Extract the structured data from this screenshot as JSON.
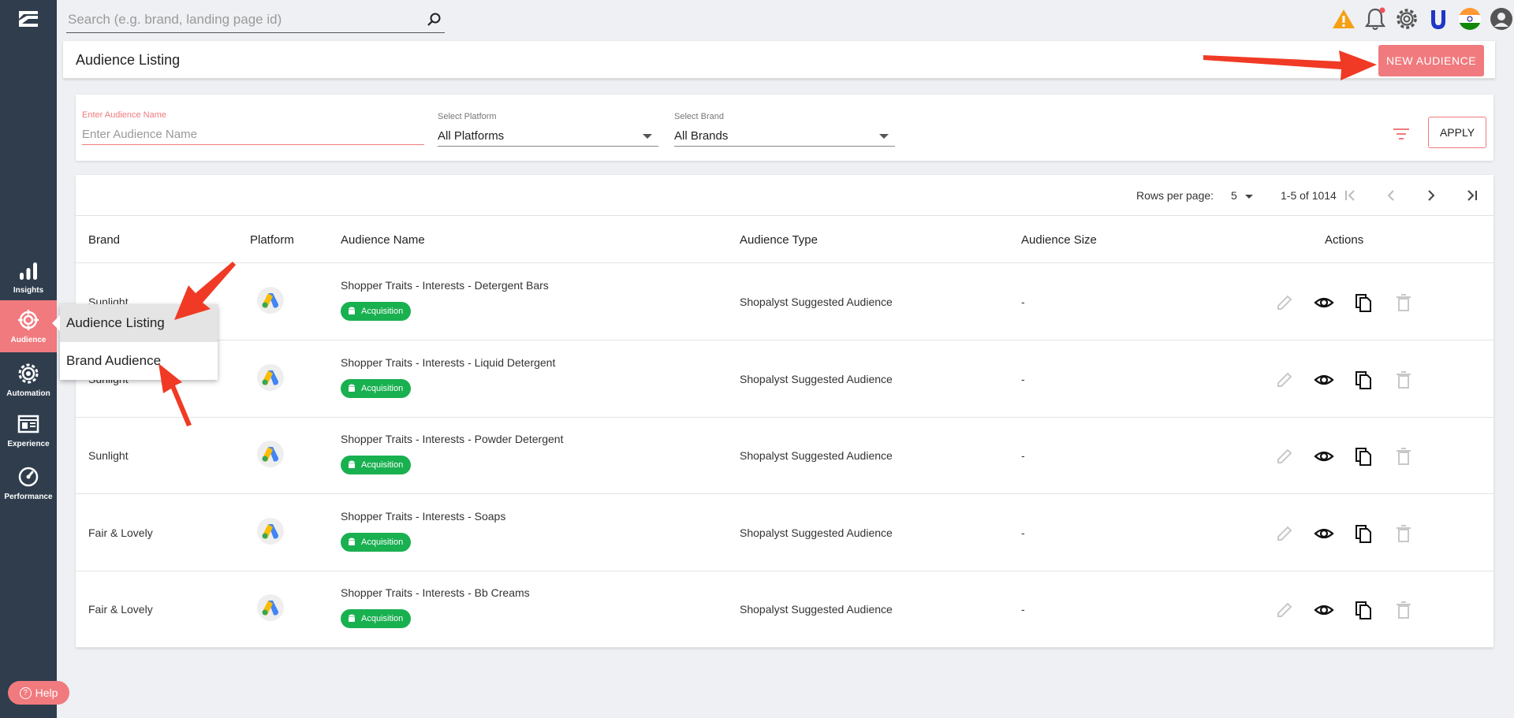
{
  "search": {
    "placeholder": "Search (e.g. brand, landing page id)"
  },
  "sidebar": {
    "items": [
      {
        "label": "Insights",
        "icon": "bar-chart-icon"
      },
      {
        "label": "Audience",
        "icon": "target-icon",
        "active": true
      },
      {
        "label": "Automation",
        "icon": "gear-icon"
      },
      {
        "label": "Experience",
        "icon": "layout-icon"
      },
      {
        "label": "Performance",
        "icon": "gauge-icon"
      }
    ],
    "help_label": "Help"
  },
  "header": {
    "title": "Audience Listing",
    "new_button": "NEW AUDIENCE"
  },
  "filters": {
    "name_label": "Enter Audience Name",
    "name_placeholder": "Enter Audience Name",
    "platform_label": "Select Platform",
    "platform_value": "All Platforms",
    "brand_label": "Select Brand",
    "brand_value": "All Brands",
    "apply_label": "APPLY"
  },
  "pagination": {
    "rows_label": "Rows per page:",
    "rows_value": "5",
    "range": "1-5 of 1014"
  },
  "table": {
    "columns": [
      "Brand",
      "Platform",
      "Audience Name",
      "Audience Type",
      "Audience Size",
      "Actions"
    ],
    "rows": [
      {
        "brand": "Sunlight",
        "name": "Shopper Traits - Interests - Detergent Bars",
        "badge": "Acquisition",
        "type": "Shopalyst Suggested Audience",
        "size": "-"
      },
      {
        "brand": "Sunlight",
        "name": "Shopper Traits - Interests - Liquid Detergent",
        "badge": "Acquisition",
        "type": "Shopalyst Suggested Audience",
        "size": "-"
      },
      {
        "brand": "Sunlight",
        "name": "Shopper Traits - Interests - Powder Detergent",
        "badge": "Acquisition",
        "type": "Shopalyst Suggested Audience",
        "size": "-"
      },
      {
        "brand": "Fair & Lovely",
        "name": "Shopper Traits - Interests - Soaps",
        "badge": "Acquisition",
        "type": "Shopalyst Suggested Audience",
        "size": "-"
      },
      {
        "brand": "Fair & Lovely",
        "name": "Shopper Traits - Interests - Bb Creams",
        "badge": "Acquisition",
        "type": "Shopalyst Suggested Audience",
        "size": "-"
      }
    ]
  },
  "popup": {
    "items": [
      "Audience Listing",
      "Brand Audience"
    ]
  },
  "colors": {
    "accent": "#f07a7e",
    "sidebar": "#2f3d4d",
    "badge": "#19b050",
    "arrow": "#f03a25"
  }
}
